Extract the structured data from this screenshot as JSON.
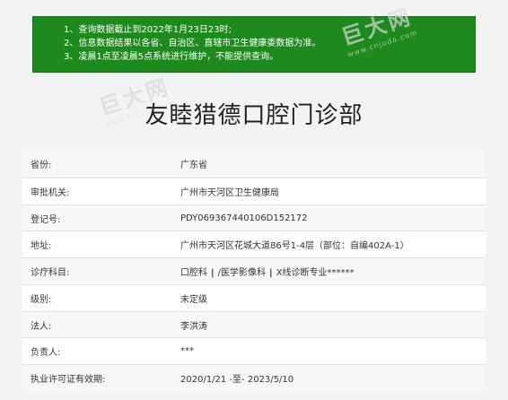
{
  "notice": {
    "lines": [
      "1、查询数据截止到2022年1月23日23时;",
      "2、信息数据结果以各省、自治区、直辖市卫生健康委数据为准。",
      "3、凌晨1点至凌晨5点系统进行维护，不能提供查询。"
    ]
  },
  "page_title": "友睦猎德口腔门诊部",
  "rows": [
    {
      "label": "省份:",
      "value": "广东省"
    },
    {
      "label": "审批机关:",
      "value": "广州市天河区卫生健康局"
    },
    {
      "label": "登记号:",
      "value": "PDY069367440106D152172"
    },
    {
      "label": "地址:",
      "value": "广州市天河区花城大道86号1-4层（部位：自编402A-1）"
    },
    {
      "label": "诊疗科目:",
      "values": [
        "口腔科",
        "/医学影像科",
        "X线诊断专业******"
      ]
    },
    {
      "label": "级别:",
      "value": "未定级"
    },
    {
      "label": "法人:",
      "value": "李洪涛"
    },
    {
      "label": "负责人:",
      "value": "***"
    },
    {
      "label": "执业许可证有效期:",
      "value": "2020/1/21 -至- 2023/5/10"
    }
  ],
  "watermark": {
    "text": "巨大网",
    "url": "www.cnjuda.com"
  }
}
